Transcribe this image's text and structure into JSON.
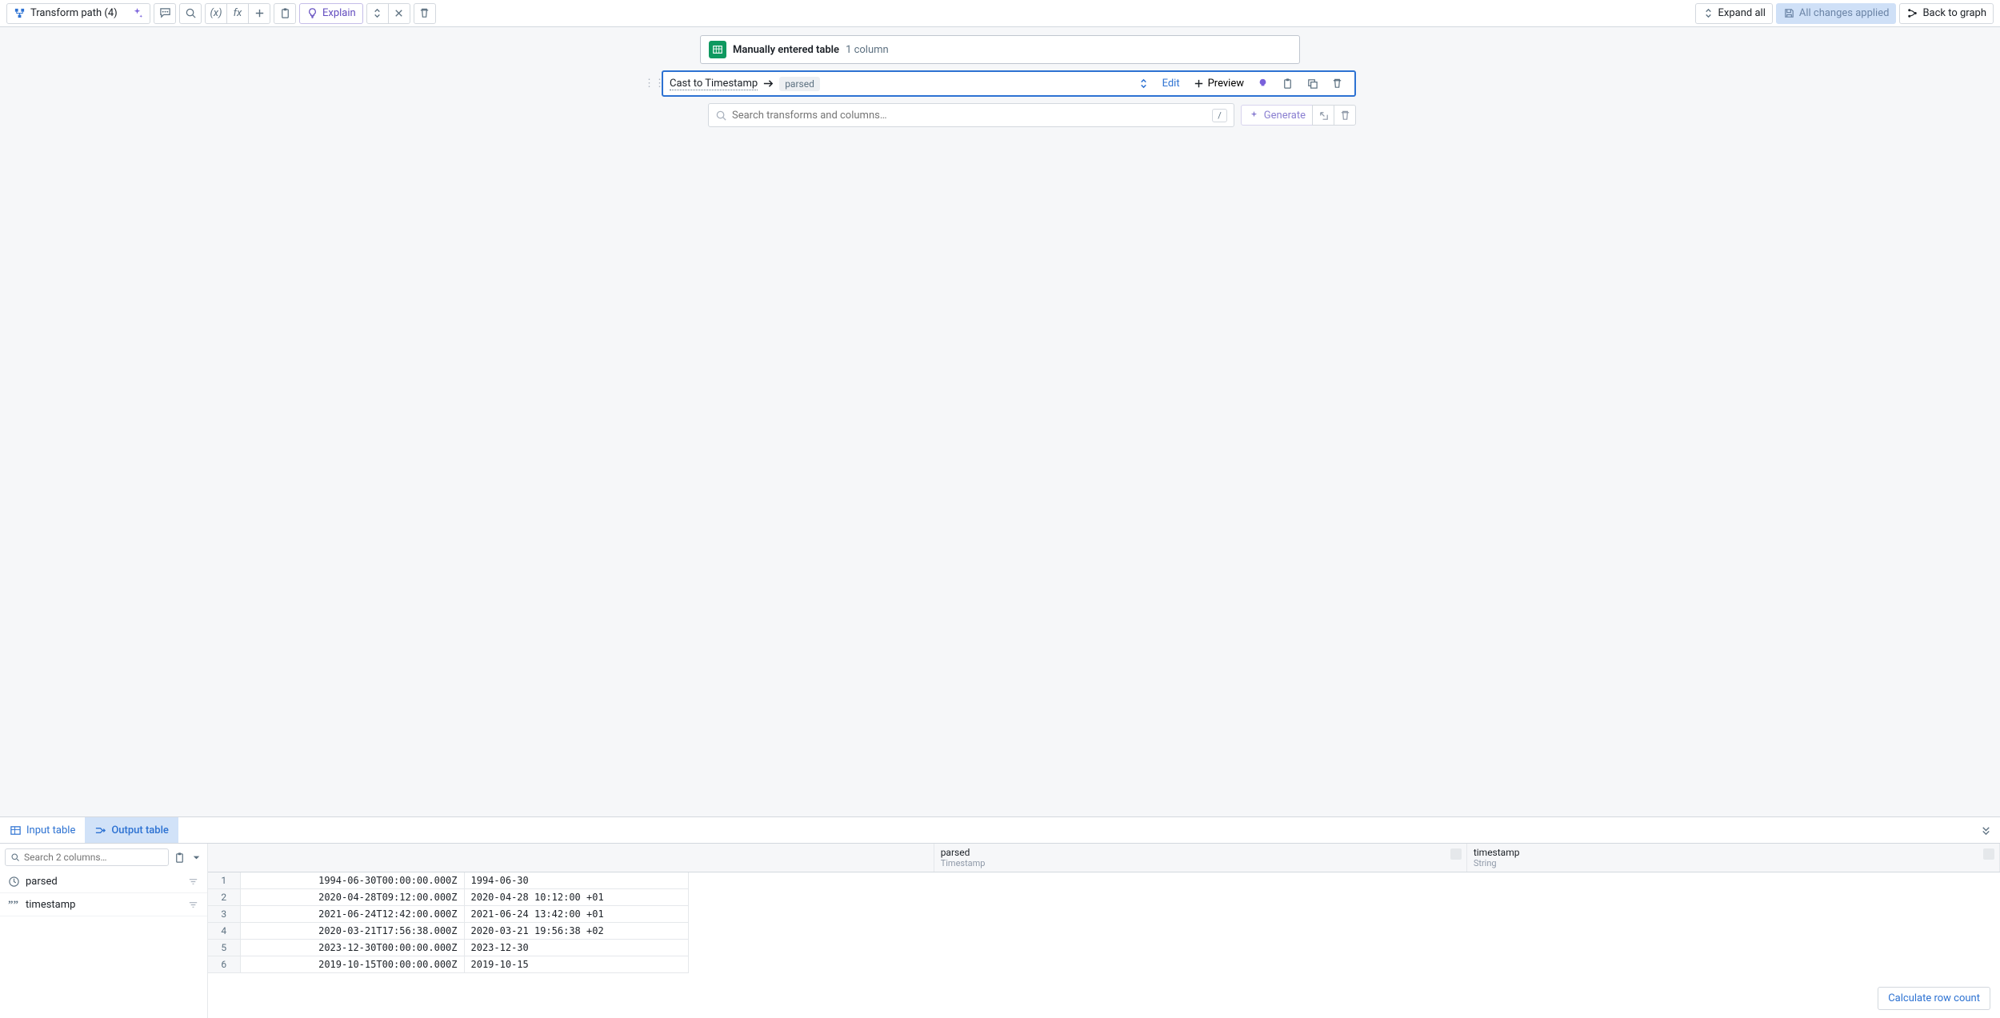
{
  "toolbar": {
    "title": "Transform path (4)",
    "explain": "Explain",
    "expand_all": "Expand all",
    "changes_applied": "All changes applied",
    "back_to_graph": "Back to graph"
  },
  "source_node": {
    "title": "Manually entered table",
    "subtitle": "1 column"
  },
  "transform_node": {
    "title": "Cast to Timestamp",
    "output_tag": "parsed",
    "edit": "Edit",
    "preview": "Preview"
  },
  "search": {
    "placeholder": "Search transforms and columns…",
    "slash": "/",
    "generate": "Generate"
  },
  "tabs": {
    "input": "Input table",
    "output": "Output table"
  },
  "columns_panel": {
    "search_placeholder": "Search 2 columns…",
    "items": [
      {
        "name": "parsed",
        "type_icon": "clock"
      },
      {
        "name": "timestamp",
        "type_icon": "quote"
      }
    ]
  },
  "grid_headers": [
    {
      "name": "parsed",
      "type": "Timestamp"
    },
    {
      "name": "timestamp",
      "type": "String"
    }
  ],
  "grid_rows": [
    {
      "n": 1,
      "parsed": "1994-06-30T00:00:00.000Z",
      "timestamp": "1994-06-30"
    },
    {
      "n": 2,
      "parsed": "2020-04-28T09:12:00.000Z",
      "timestamp": "2020-04-28 10:12:00 +01"
    },
    {
      "n": 3,
      "parsed": "2021-06-24T12:42:00.000Z",
      "timestamp": "2021-06-24 13:42:00 +01"
    },
    {
      "n": 4,
      "parsed": "2020-03-21T17:56:38.000Z",
      "timestamp": "2020-03-21 19:56:38 +02"
    },
    {
      "n": 5,
      "parsed": "2023-12-30T00:00:00.000Z",
      "timestamp": "2023-12-30"
    },
    {
      "n": 6,
      "parsed": "2019-10-15T00:00:00.000Z",
      "timestamp": "2019-10-15"
    }
  ],
  "calc_row_count": "Calculate row count"
}
